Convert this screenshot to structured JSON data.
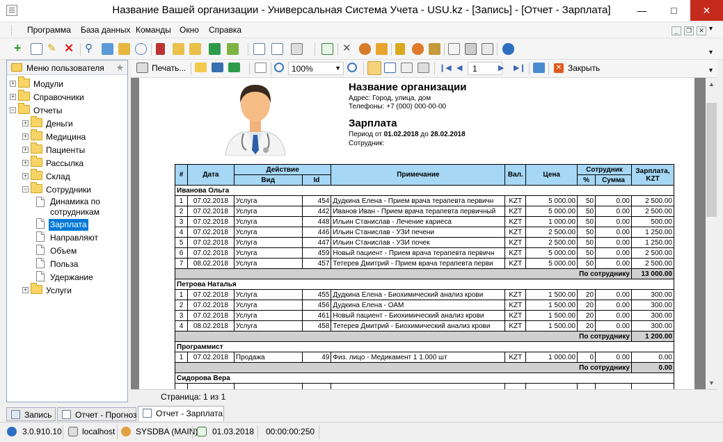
{
  "window": {
    "title": "Название Вашей организации - Универсальная Система Учета - USU.kz - [Запись] - [Отчет - Зарплата]"
  },
  "menu": [
    "Программа",
    "База данных",
    "Команды",
    "Окно",
    "Справка"
  ],
  "left_panel": {
    "title": "Меню пользователя",
    "tree": [
      {
        "label": "Модули",
        "type": "folder",
        "level": 0,
        "expander": "+"
      },
      {
        "label": "Справочники",
        "type": "folder",
        "level": 0,
        "expander": "+"
      },
      {
        "label": "Отчеты",
        "type": "folder",
        "level": 0,
        "expander": "−"
      },
      {
        "label": "Деньги",
        "type": "folder",
        "level": 1,
        "expander": "+"
      },
      {
        "label": "Медицина",
        "type": "folder",
        "level": 1,
        "expander": "+"
      },
      {
        "label": "Пациенты",
        "type": "folder",
        "level": 1,
        "expander": "+"
      },
      {
        "label": "Рассылка",
        "type": "folder",
        "level": 1,
        "expander": "+"
      },
      {
        "label": "Склад",
        "type": "folder",
        "level": 1,
        "expander": "+"
      },
      {
        "label": "Сотрудники",
        "type": "folder",
        "level": 1,
        "expander": "−"
      },
      {
        "label": "Динамика по",
        "label2": "сотрудникам",
        "type": "doc",
        "level": 2
      },
      {
        "label": "Зарплата",
        "type": "doc",
        "level": 2,
        "selected": true
      },
      {
        "label": "Направляют",
        "type": "doc",
        "level": 2
      },
      {
        "label": "Объем",
        "type": "doc",
        "level": 2
      },
      {
        "label": "Польза",
        "type": "doc",
        "level": 2
      },
      {
        "label": "Удержание",
        "type": "doc",
        "level": 2
      },
      {
        "label": "Услуги",
        "type": "folder",
        "level": 1,
        "expander": "+"
      }
    ]
  },
  "report_toolbar": {
    "print_label": "Печать...",
    "zoom": "100%",
    "page_number": "1",
    "close_label": "Закрыть"
  },
  "report": {
    "org_name": "Название организации",
    "address": "Адрес: Город, улица, дом",
    "phones": "Телефоны: +7 (000) 000-00-00",
    "title": "Зарплата",
    "period_prefix": "Период от ",
    "period_from": "01.02.2018",
    "period_mid": " до ",
    "period_to": "28.02.2018",
    "employee_label": "Сотрудник:",
    "headers": {
      "num": "#",
      "date": "Дата",
      "action": "Действие",
      "kind": "Вид",
      "id": "Id",
      "note": "Примечание",
      "cur": "Вал.",
      "price": "Цена",
      "staff": "Сотрудник",
      "pct": "%",
      "sum": "Сумма",
      "salary": "Зарплата,",
      "salary2": "KZT"
    },
    "subtotal_label": "По сотруднику",
    "groups": [
      {
        "name": "Иванова Ольга",
        "rows": [
          [
            "1",
            "07.02.2018",
            "Услуга",
            "454",
            "Дудкина Елена - Прием врача терапевта первичн",
            "KZT",
            "5 000.00",
            "50",
            "0.00",
            "2 500.00"
          ],
          [
            "2",
            "07.02.2018",
            "Услуга",
            "442",
            "Иванов Иван - Прием врача терапевта первичный",
            "KZT",
            "5 000.00",
            "50",
            "0.00",
            "2 500.00"
          ],
          [
            "3",
            "07.02.2018",
            "Услуга",
            "448",
            "Ильин Станислав - Лечение кариеса",
            "KZT",
            "1 000.00",
            "50",
            "0.00",
            "500.00"
          ],
          [
            "4",
            "07.02.2018",
            "Услуга",
            "446",
            "Ильин Станислав - УЗИ печени",
            "KZT",
            "2 500.00",
            "50",
            "0.00",
            "1 250.00"
          ],
          [
            "5",
            "07.02.2018",
            "Услуга",
            "447",
            "Ильин Станислав - УЗИ почек",
            "KZT",
            "2 500.00",
            "50",
            "0.00",
            "1 250.00"
          ],
          [
            "6",
            "07.02.2018",
            "Услуга",
            "459",
            "Новый пациент - Прием врача терапевта первичн",
            "KZT",
            "5 000.00",
            "50",
            "0.00",
            "2 500.00"
          ],
          [
            "7",
            "08.02.2018",
            "Услуга",
            "457",
            "Тетерев Дмитрий - Прием врача терапевта перви",
            "KZT",
            "5 000.00",
            "50",
            "0.00",
            "2 500.00"
          ]
        ],
        "total": "13 000.00"
      },
      {
        "name": "Петрова Наталья",
        "rows": [
          [
            "1",
            "07.02.2018",
            "Услуга",
            "455",
            "Дудкина Елена - Биохимический анализ крови",
            "KZT",
            "1 500.00",
            "20",
            "0.00",
            "300.00"
          ],
          [
            "2",
            "07.02.2018",
            "Услуга",
            "456",
            "Дудкина Елена - ОАМ",
            "KZT",
            "1 500.00",
            "20",
            "0.00",
            "300.00"
          ],
          [
            "3",
            "07.02.2018",
            "Услуга",
            "461",
            "Новый пациент - Биохимический анализ крови",
            "KZT",
            "1 500.00",
            "20",
            "0.00",
            "300.00"
          ],
          [
            "4",
            "08.02.2018",
            "Услуга",
            "458",
            "Тетерев Дмитрий - Биохимический анализ крови",
            "KZT",
            "1 500.00",
            "20",
            "0.00",
            "300.00"
          ]
        ],
        "total": "1 200.00"
      },
      {
        "name": "Программист",
        "rows": [
          [
            "1",
            "07.02.2018",
            "Продажа",
            "49",
            "Физ. лицо - Медикамент 1 1.000 шт",
            "KZT",
            "1 000.00",
            "0",
            "0.00",
            "0.00"
          ]
        ],
        "total": "0.00"
      },
      {
        "name": "Сидорова Вера",
        "rows": [],
        "total": ""
      }
    ]
  },
  "page_status": "Страница: 1 из 1",
  "tabs": [
    "Запись",
    "Отчет - Прогноз",
    "Отчет - Зарплата"
  ],
  "status_bar": {
    "version": "3.0.910.10",
    "host": "localhost",
    "user": "SYSDBA (MAIN)",
    "date": "01.03.2018",
    "timer": "00:00:00:250"
  }
}
